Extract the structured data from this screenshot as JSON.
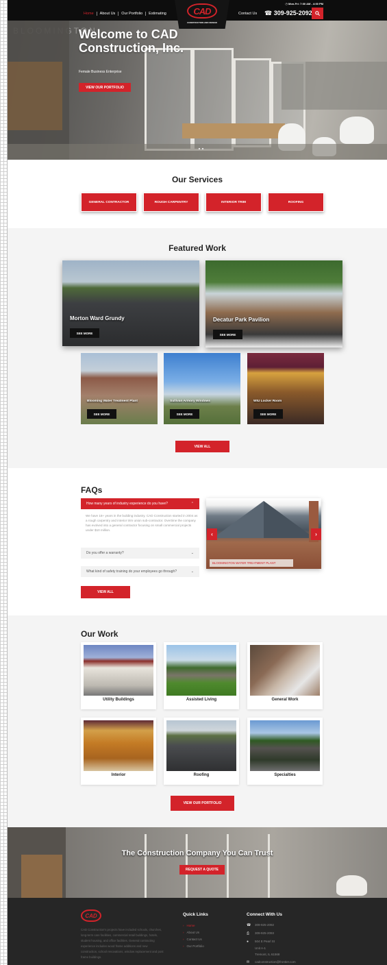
{
  "header": {
    "hours": "Mon-Fri: 7:00 AM - 4:00 PM",
    "nav": [
      "Home",
      "About Us",
      "Our Portfolio",
      "Estimating"
    ],
    "logo_text": "CAD",
    "logo_subtitle": "CONSTRUCTION AND DESIGN",
    "contact": "Contact Us",
    "phone": "309-925-2092",
    "search_icon": "search-icon",
    "colors": {
      "accent": "#d3232a",
      "bar": "#0d0d0d"
    }
  },
  "hero": {
    "watermark": "BLOOMINGTON",
    "title": "Welcome to CAD Construction, Inc.",
    "subtitle": "Female Business Enterprise",
    "button": "VIEW OUR PORTFOLIO"
  },
  "services": {
    "title": "Our Services",
    "items": [
      "GENERAL CONTRACTOR",
      "ROUGH CARPENTRY",
      "INTERIOR TRIM",
      "ROOFING"
    ]
  },
  "featured": {
    "title": "Featured Work",
    "large": [
      {
        "title": "Morton Ward Grundy",
        "button": "SEE MORE"
      },
      {
        "title": "Decatur Park Pavilion",
        "button": "SEE MORE"
      }
    ],
    "small": [
      {
        "title": "Blooming Water Treatment Plant",
        "button": "SEE MORE"
      },
      {
        "title": "Sullivan Armory Windows",
        "button": "SEE MORE"
      },
      {
        "title": "WIU Locker Room",
        "button": "SEE MORE"
      }
    ],
    "view_all": "VIEW ALL"
  },
  "faqs": {
    "title": "FAQs",
    "items": [
      {
        "q": "How many years of industry experience do you have?",
        "a": "We have 16+ years in the building industry. CAD Construction started in 2004 as a rough carpentry and interior trim union sub-contractor. Overtime the company has evolved into a general contractor focusing on small commercial projects under $10 million."
      },
      {
        "q": "Do you offer a warranty?"
      },
      {
        "q": "What kind of safety training do your employees go through?"
      }
    ],
    "view_all": "VIEW ALL",
    "slide_caption": "BLOOMINGTON WATER TREATMENT PLANT"
  },
  "our_work": {
    "title": "Our Work",
    "items": [
      "Utility Buildings",
      "Assisted Living",
      "General Work",
      "Interior",
      "Roofing",
      "Specialties"
    ],
    "button": "VIEW OUR PORTFOLIO"
  },
  "cta": {
    "title": "The Construction Company You Can Trust",
    "button": "REQUEST A QUOTE"
  },
  "footer": {
    "logo_text": "CAD",
    "description": "CAD Construction's projects have included schools, churches, long-term care facilities, commercial retail buildings, hotels, student housing, and office facilities. General contracting experience includes wood frame additions and new construction, school renovations, window replacement and post frame buildings.",
    "quick_links_title": "Quick Links",
    "quick_links": [
      "Home",
      "About Us",
      "Contact Us",
      "Our Portfolio"
    ],
    "connect_title": "Connect With Us",
    "connect": [
      {
        "icon": "phone-icon",
        "text": "309-925-2092"
      },
      {
        "icon": "fax-icon",
        "text": "309-925-2093"
      },
      {
        "icon": "map-pin-icon",
        "text": "504 E Pearl St"
      },
      {
        "icon": "",
        "text": "Unit A-1"
      },
      {
        "icon": "",
        "text": "Tremont, IL 61568"
      },
      {
        "icon": "email-icon",
        "text": "cadconstruction@frontier.com"
      }
    ]
  }
}
